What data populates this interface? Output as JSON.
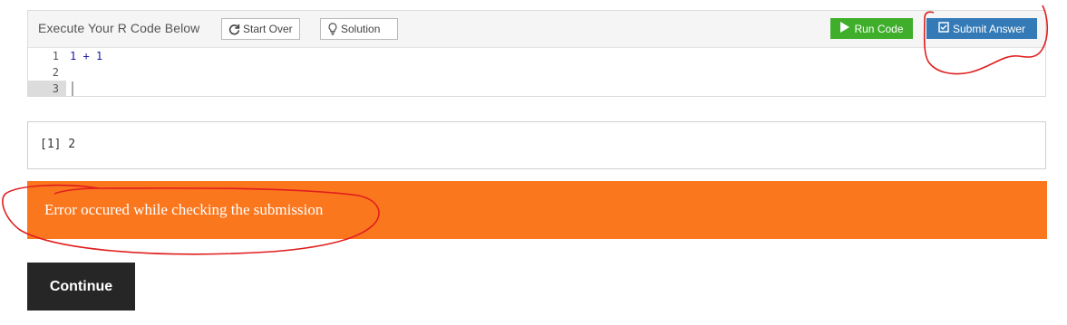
{
  "toolbar": {
    "title": "Execute Your R Code Below",
    "start_over_label": "Start Over",
    "solution_label": "Solution",
    "run_label": "Run Code",
    "submit_label": "Submit Answer"
  },
  "editor": {
    "line_numbers": [
      "1",
      "2",
      "3"
    ],
    "lines": [
      "1 + 1",
      "",
      ""
    ],
    "active_line": 3
  },
  "output": {
    "text": "[1] 2"
  },
  "alert": {
    "message": "Error occured while checking the submission"
  },
  "continue_label": "Continue",
  "colors": {
    "run": "#3fae2a",
    "submit": "#337ab7",
    "alert": "#fb771e",
    "continue": "#262626",
    "annotation": "#e01e1e"
  }
}
